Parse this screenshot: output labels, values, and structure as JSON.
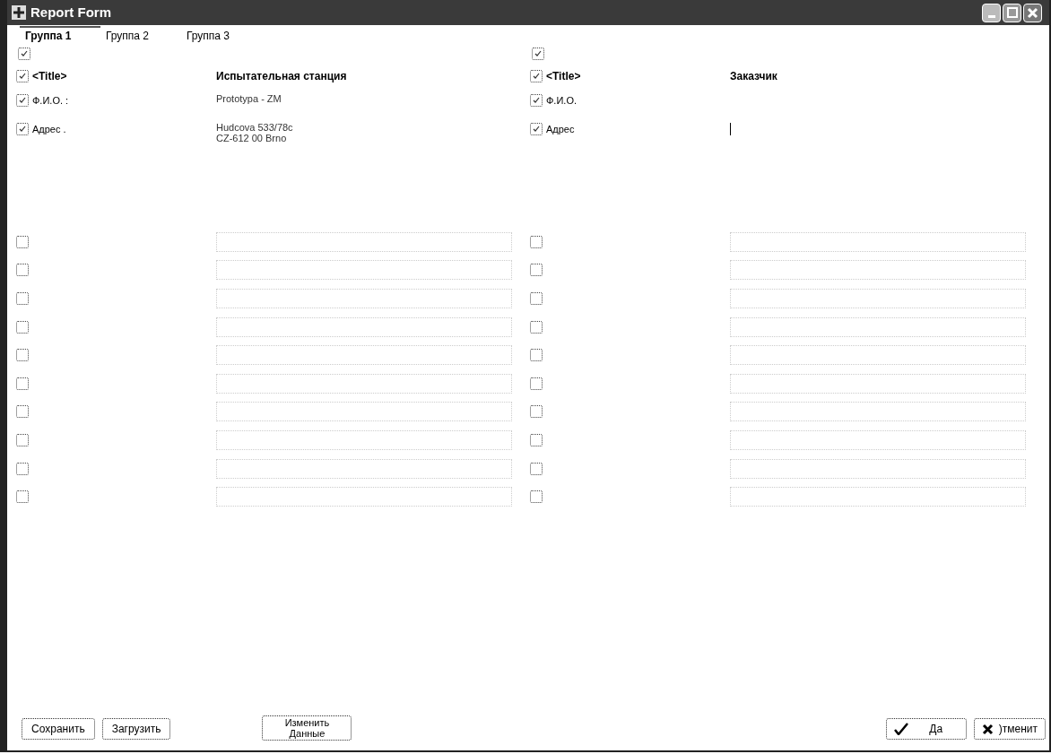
{
  "window": {
    "title": "Report Form"
  },
  "tabs": [
    {
      "label": "Группа 1",
      "selected": true
    },
    {
      "label": "Группа 2",
      "selected": false
    },
    {
      "label": "Группа 3",
      "selected": false
    }
  ],
  "panels": [
    {
      "header_checked": true,
      "rows": [
        {
          "kind": "title",
          "checked": true,
          "label": "<Title>",
          "value": "Испытательная станция"
        },
        {
          "kind": "field",
          "checked": true,
          "label": "Ф.И.О. :",
          "value": "Prototypa - ZM"
        },
        {
          "kind": "field",
          "checked": true,
          "label": "Адрес .",
          "value": "Hudcova 533/78c\nCZ-612 00 Brno"
        }
      ],
      "extra_rows": [
        {
          "checked": false
        },
        {
          "checked": false
        },
        {
          "checked": false
        },
        {
          "checked": false
        },
        {
          "checked": false
        },
        {
          "checked": false
        },
        {
          "checked": false
        },
        {
          "checked": false
        },
        {
          "checked": false
        },
        {
          "checked": false
        }
      ]
    },
    {
      "header_checked": true,
      "rows": [
        {
          "kind": "title",
          "checked": true,
          "label": "<Title>",
          "value": "Заказчик"
        },
        {
          "kind": "field",
          "checked": true,
          "label": "Ф.И.О."
        },
        {
          "kind": "cursor",
          "checked": true,
          "label": "Адрес"
        }
      ],
      "extra_rows": [
        {
          "checked": false
        },
        {
          "checked": false
        },
        {
          "checked": false
        },
        {
          "checked": false
        },
        {
          "checked": false
        },
        {
          "checked": false
        },
        {
          "checked": false
        },
        {
          "checked": false
        },
        {
          "checked": false
        },
        {
          "checked": false
        }
      ]
    }
  ],
  "buttons_left": [
    {
      "label": "Сохранить"
    },
    {
      "label": "Загрузить"
    }
  ],
  "button_center": {
    "label": "Изменить\nДанные"
  },
  "buttons_right": [
    {
      "kind": "ok",
      "label": "Да"
    },
    {
      "kind": "cancel",
      "label": ")тменит"
    }
  ]
}
